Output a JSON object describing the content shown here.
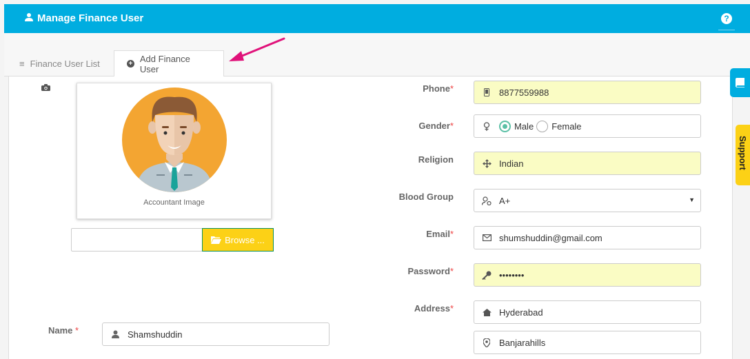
{
  "header": {
    "title": "Manage Finance User",
    "help_label": "?"
  },
  "tabs": [
    {
      "label": "Finance User List",
      "active": false
    },
    {
      "label": "Add Finance User",
      "active": true
    }
  ],
  "photo": {
    "caption": "Accountant Image",
    "browse_label": "Browse ..."
  },
  "form": {
    "name": {
      "label": "Name",
      "value": "Shamshuddin"
    },
    "phone": {
      "label": "Phone",
      "value": "8877559988"
    },
    "gender": {
      "label": "Gender",
      "options": [
        "Male",
        "Female"
      ],
      "selected": "Male"
    },
    "religion": {
      "label": "Religion",
      "value": "Indian"
    },
    "blood_group": {
      "label": "Blood Group",
      "value": "A+"
    },
    "email": {
      "label": "Email",
      "value": "shumshuddin@gmail.com"
    },
    "password": {
      "label": "Password",
      "value": "••••••••"
    },
    "address": {
      "label": "Address",
      "line1": "Hyderabad",
      "line2": "Banjarahills"
    },
    "required_mark": "*"
  },
  "side": {
    "support_label": "Support"
  },
  "colors": {
    "header": "#00ade0",
    "browse": "#fcd116",
    "highlight": "#fafcc4",
    "radio": "#5bc0a6",
    "arrow": "#e0127a"
  }
}
